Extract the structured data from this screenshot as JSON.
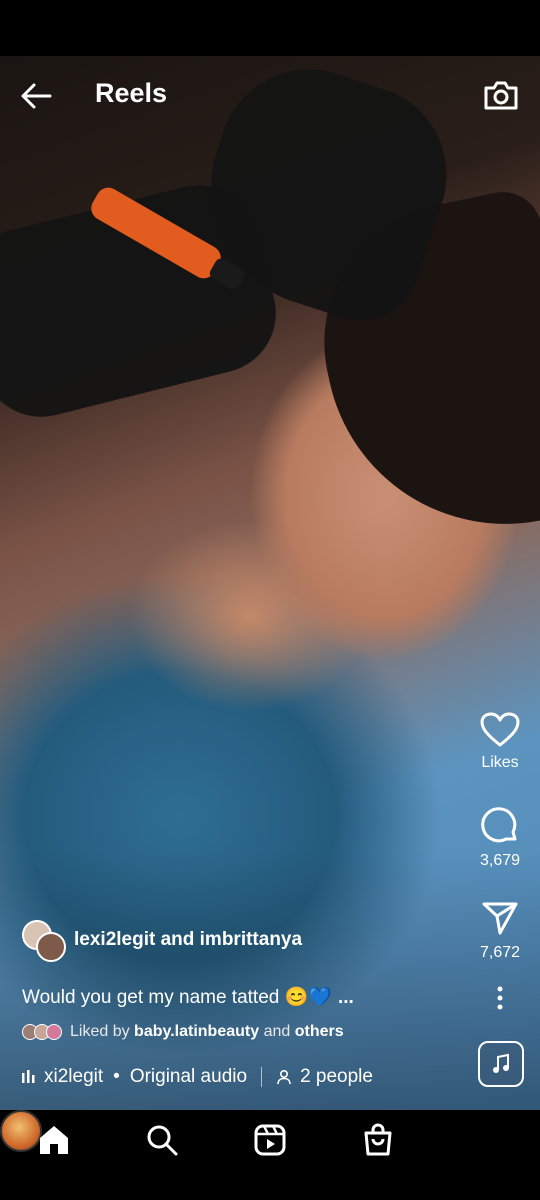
{
  "header": {
    "title": "Reels",
    "back_icon": "arrow-left-icon",
    "camera_icon": "camera-icon"
  },
  "actions": {
    "likes_label": "Likes",
    "comments_count": "3,679",
    "shares_count": "7,672"
  },
  "post": {
    "authors": "lexi2legit and imbrittanya",
    "caption": "Would you get my name tatted 😊💙",
    "caption_more": "...",
    "liked_by_prefix": "Liked by",
    "liked_by_user": "baby.latinbeauty",
    "liked_by_and": "and",
    "liked_by_others": "others",
    "audio_user": "xi2legit",
    "audio_separator": "•",
    "audio_title": "Original audio",
    "people": "2 people"
  },
  "bottom_nav": [
    "home-icon",
    "search-icon",
    "reels-icon",
    "shop-icon",
    "profile-avatar"
  ],
  "colors": {
    "background": "#000000",
    "text": "#ffffff"
  }
}
